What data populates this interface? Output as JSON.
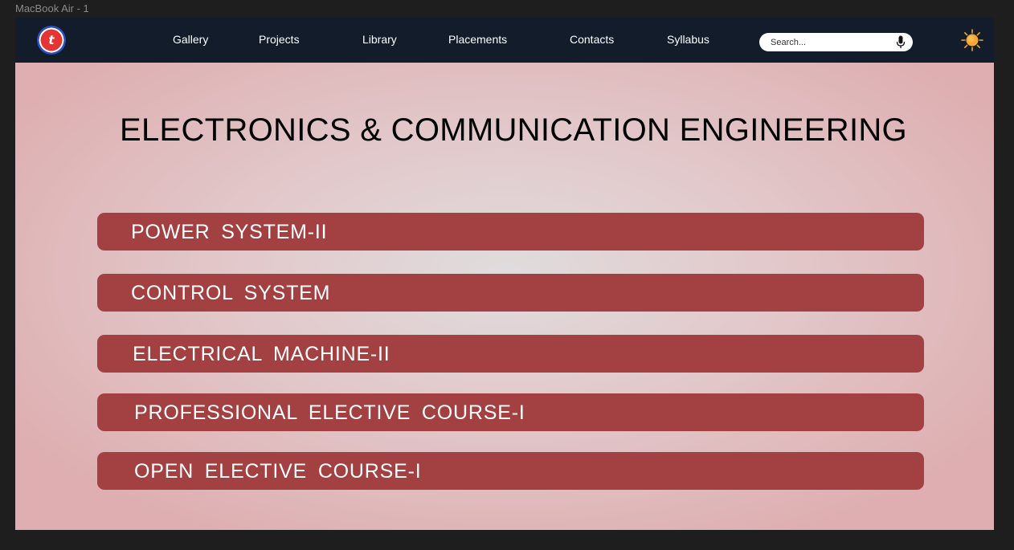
{
  "frame_label": "MacBook Air - 1",
  "navbar": {
    "logo_text": "t",
    "links": [
      "Gallery",
      "Projects",
      "Library",
      "Placements",
      "Contacts",
      "Syllabus"
    ],
    "search_placeholder": "Search..."
  },
  "page_title": "ELECTRONICS & COMMUNICATION ENGINEERING",
  "subjects": [
    "POWER  SYSTEM-II",
    "CONTROL  SYSTEM",
    "ELECTRICAL  MACHINE-II",
    "PROFESSIONAL  ELECTIVE  COURSE-I",
    "OPEN  ELECTIVE  COURSE-I"
  ],
  "colors": {
    "navbar": "#121c2b",
    "subject_bar": "#a34042",
    "hero_edge": "#deaeb0",
    "hero_center": "#e0dcdd"
  },
  "icons": {
    "search": "microphone-icon",
    "theme": "sun-icon"
  }
}
